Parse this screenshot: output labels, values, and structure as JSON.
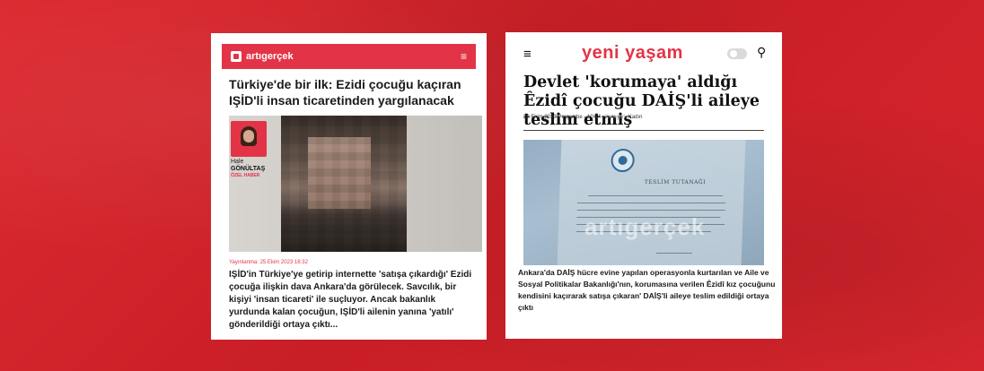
{
  "left_article": {
    "site_logo": "artıgerçek",
    "menu_icon": "menu-icon",
    "title": "Türkiye'de bir ilk: Ezidi çocuğu kaçıran IŞİD'li insan ticaretinden yargılanacak",
    "author_first": "Hale",
    "author_last": "GÖNÜLTAŞ",
    "author_tag": "ÖZEL HABER",
    "date": "Yayınlanma: 25 Ekim 2023 18:32",
    "body": "IŞİD'in Türkiye'ye getirip internette 'satışa çıkardığı' Ezidi çocuğa ilişkin dava Ankara'da görülecek. Savcılık, bir kişiyi 'insan ticareti' ile suçluyor. Ancak bakanlık yurdunda kalan çocuğun, IŞİD'li ailenin yanına 'yatılı' gönderildiği ortaya çıktı..."
  },
  "right_article": {
    "site_logo": "yeni yaşam",
    "menu_icon": "menu-icon",
    "search_icon": "search-icon",
    "title": "Devlet 'korumaya' aldığı Êzidî çocuğu DAİŞ'li aileye teslim etmiş",
    "date": "26 Ekim 2023 Perşembe - 10:24",
    "category_key": "Kategori:",
    "category_value": "Kadın",
    "doc_title": "TESLİM TUTANAĞI",
    "watermark": "artıgerçek",
    "body": "Ankara'da DAİŞ hücre evine yapılan operasyonla kurtarılan ve Aile ve Sosyal Politikalar Bakanlığı'nın, korumasına verilen Êzidî kız çocuğunu kendisini kaçırarak satışa çıkaran' DAİŞ'li aileye teslim edildiği ortaya çıktı"
  },
  "colors": {
    "background": "#d7242c",
    "accent": "#e33447"
  }
}
